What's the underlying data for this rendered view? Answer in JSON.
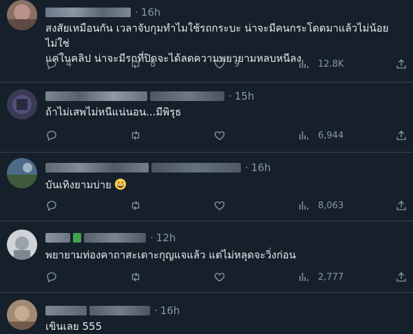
{
  "tweets": [
    {
      "time": "16h",
      "text_line1": "สงสัยเหมือนกัน เวลาจับกุมทำไมใช้รถกระบะ น่าจะมีคนกระโดดมาแล้วไม่น้อย ไม่ใช่",
      "text_line2": "แค่ในคลิป น่าจะมีรถที่ปิดจะได้ลดความพยายามหลบหนีลง",
      "replies": "4",
      "retweets": "8",
      "likes": "9",
      "views": "12.8K"
    },
    {
      "time": "15h",
      "text_line1": "ถ้าไม่เสพไม่หนีแน่นอน...มีพิรุธ",
      "replies": "",
      "retweets": "",
      "likes": "",
      "views": "6,944"
    },
    {
      "time": "16h",
      "text_line1": "บันเทิงยามบ่าย",
      "emoji": "grinning-face-emoji",
      "replies": "",
      "retweets": "",
      "likes": "",
      "views": "8,063"
    },
    {
      "time": "12h",
      "text_line1": "พยายามท่องคาถาสะเดาะกุญแจแล้ว แต่ไม่หลุดจะวิ่งก่อน",
      "replies": "",
      "retweets": "",
      "likes": "",
      "views": "2,777"
    },
    {
      "time": "16h",
      "text_line1": "เขินเลย 555"
    }
  ],
  "icons": {
    "reply": "reply-icon",
    "retweet": "retweet-icon",
    "like": "heart-icon",
    "views": "views-icon",
    "share": "share-icon"
  },
  "colors": {
    "background": "#15202b",
    "text": "#e7e9ea",
    "muted": "#8b98a5",
    "divider": "#38444d"
  }
}
